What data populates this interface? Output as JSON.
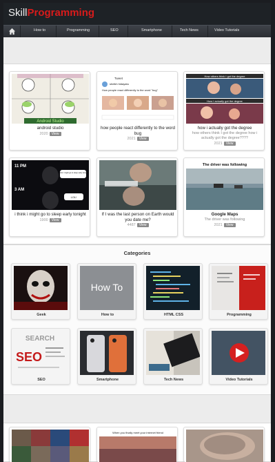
{
  "logo": {
    "skill": "Skill",
    "programming": "Programming"
  },
  "nav": {
    "items": [
      {
        "label": "How to"
      },
      {
        "label": "Programming"
      },
      {
        "label": "SEO"
      },
      {
        "label": "Smartphone"
      },
      {
        "label": "Tech News"
      },
      {
        "label": "Video Tutorials"
      }
    ]
  },
  "posts": [
    {
      "title": "android studio",
      "subtitle": "",
      "views": "2020",
      "button": "View"
    },
    {
      "title": "how people react differently to the word bug",
      "subtitle": "",
      "views": "2021",
      "button": "View"
    },
    {
      "title": "how i actually got the degree",
      "subtitle": "how others think I got the degree how i actually got the degree????",
      "views": "2021",
      "button": "View"
    },
    {
      "title": "i think i might go to sleep early tonight",
      "subtitle": "",
      "views": "1900",
      "button": "View"
    },
    {
      "title": "If I was the last person on Earth would you date me?",
      "subtitle": "",
      "views": "4487",
      "button": "View"
    },
    {
      "title": "Google Maps",
      "subtitle": "The driver was following",
      "views": "2021",
      "button": "View"
    }
  ],
  "thumb_text": {
    "post1": "Android Studio",
    "post2_head": "Tweet",
    "post2_user": "sheikh hidayatu",
    "post2_text": "How people react differently to the word \"bug\"",
    "post3_top": "How others think I got the degree",
    "post3_bottom": "How I actually got the degree",
    "post4_time1": "11 PM",
    "post4_time2": "3 AM",
    "post4_bubble1": "I think I might go to sleep early tonight",
    "post4_bubble2": "LOL!",
    "post6_top": "The driver was following"
  },
  "categories_title": "Categories",
  "categories": [
    {
      "label": "Geek"
    },
    {
      "label": "How to",
      "thumb_text": "How To"
    },
    {
      "label": "HTML CSS"
    },
    {
      "label": "Programming"
    },
    {
      "label": "SEO",
      "thumb_text": "SEO",
      "thumb_text2": "SEARCH"
    },
    {
      "label": "Smartphone"
    },
    {
      "label": "Tech News"
    },
    {
      "label": "Video Tutorials"
    }
  ],
  "bottom_thumb_text": "When you finally meet your internet friend",
  "colors": {
    "brand_red": "#d81b1b",
    "header_bg": "#1e2226",
    "content_bg": "#ececec"
  }
}
